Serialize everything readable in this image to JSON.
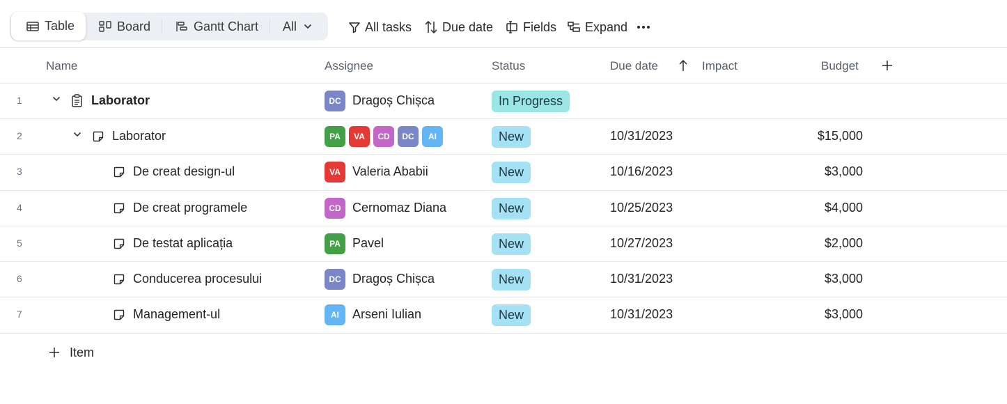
{
  "toolbar": {
    "views": [
      {
        "label": "Table",
        "icon": "table-icon",
        "active": true
      },
      {
        "label": "Board",
        "icon": "board-icon",
        "active": false
      },
      {
        "label": "Gantt Chart",
        "icon": "gantt-icon",
        "active": false
      }
    ],
    "filter_dropdown": "All",
    "tools": {
      "all_tasks": "All tasks",
      "due_date": "Due date",
      "fields": "Fields",
      "expand": "Expand"
    }
  },
  "table": {
    "columns": {
      "name": "Name",
      "assignee": "Assignee",
      "status": "Status",
      "due_date": "Due date",
      "impact": "Impact",
      "budget": "Budget"
    },
    "rows": [
      {
        "num": "1",
        "name": "Laborator",
        "assignees": [
          {
            "initials": "DC",
            "color": "#7b86c9"
          }
        ],
        "assignee_name": "Dragoș Chișca",
        "status": "In Progress",
        "status_color": "#9ae6e6",
        "due": "",
        "budget": ""
      },
      {
        "num": "2",
        "name": "Laborator",
        "assignees": [
          {
            "initials": "PA",
            "color": "#43a047"
          },
          {
            "initials": "VA",
            "color": "#e53935"
          },
          {
            "initials": "CD",
            "color": "#c266c9"
          },
          {
            "initials": "DC",
            "color": "#7b86c9"
          },
          {
            "initials": "AI",
            "color": "#64b5f6"
          }
        ],
        "assignee_name": "",
        "status": "New",
        "status_color": "#a5e1f5",
        "due": "10/31/2023",
        "budget": "$15,000"
      },
      {
        "num": "3",
        "name": "De creat design-ul",
        "assignees": [
          {
            "initials": "VA",
            "color": "#e53935"
          }
        ],
        "assignee_name": "Valeria Ababii",
        "status": "New",
        "status_color": "#a5e1f5",
        "due": "10/16/2023",
        "budget": "$3,000"
      },
      {
        "num": "4",
        "name": "De creat programele",
        "assignees": [
          {
            "initials": "CD",
            "color": "#c266c9"
          }
        ],
        "assignee_name": "Cernomaz Diana",
        "status": "New",
        "status_color": "#a5e1f5",
        "due": "10/25/2023",
        "budget": "$4,000"
      },
      {
        "num": "5",
        "name": "De testat aplicația",
        "assignees": [
          {
            "initials": "PA",
            "color": "#43a047"
          }
        ],
        "assignee_name": "Pavel",
        "status": "New",
        "status_color": "#a5e1f5",
        "due": "10/27/2023",
        "budget": "$2,000"
      },
      {
        "num": "6",
        "name": "Conducerea procesului",
        "assignees": [
          {
            "initials": "DC",
            "color": "#7b86c9"
          }
        ],
        "assignee_name": "Dragoș Chișca",
        "status": "New",
        "status_color": "#a5e1f5",
        "due": "10/31/2023",
        "budget": "$3,000"
      },
      {
        "num": "7",
        "name": "Management-ul",
        "assignees": [
          {
            "initials": "AI",
            "color": "#64b5f6"
          }
        ],
        "assignee_name": "Arseni Iulian",
        "status": "New",
        "status_color": "#a5e1f5",
        "due": "10/31/2023",
        "budget": "$3,000"
      }
    ],
    "add_item_label": "Item"
  }
}
